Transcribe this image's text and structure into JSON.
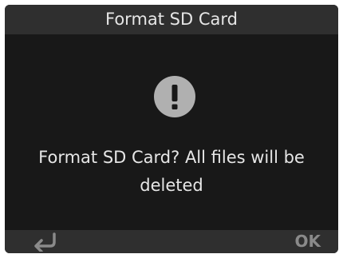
{
  "dialog": {
    "title": "Format SD Card",
    "icon": "exclamation-icon",
    "message": "Format SD Card? All files will be deleted"
  },
  "footer": {
    "back_icon": "back-arrow-icon",
    "ok_label": "OK"
  },
  "colors": {
    "background": "#181818",
    "bar": "#2f2f2f",
    "text": "#e6e6e6",
    "icon_circle": "#b0b0b0",
    "inactive": "#8a8a8a"
  }
}
